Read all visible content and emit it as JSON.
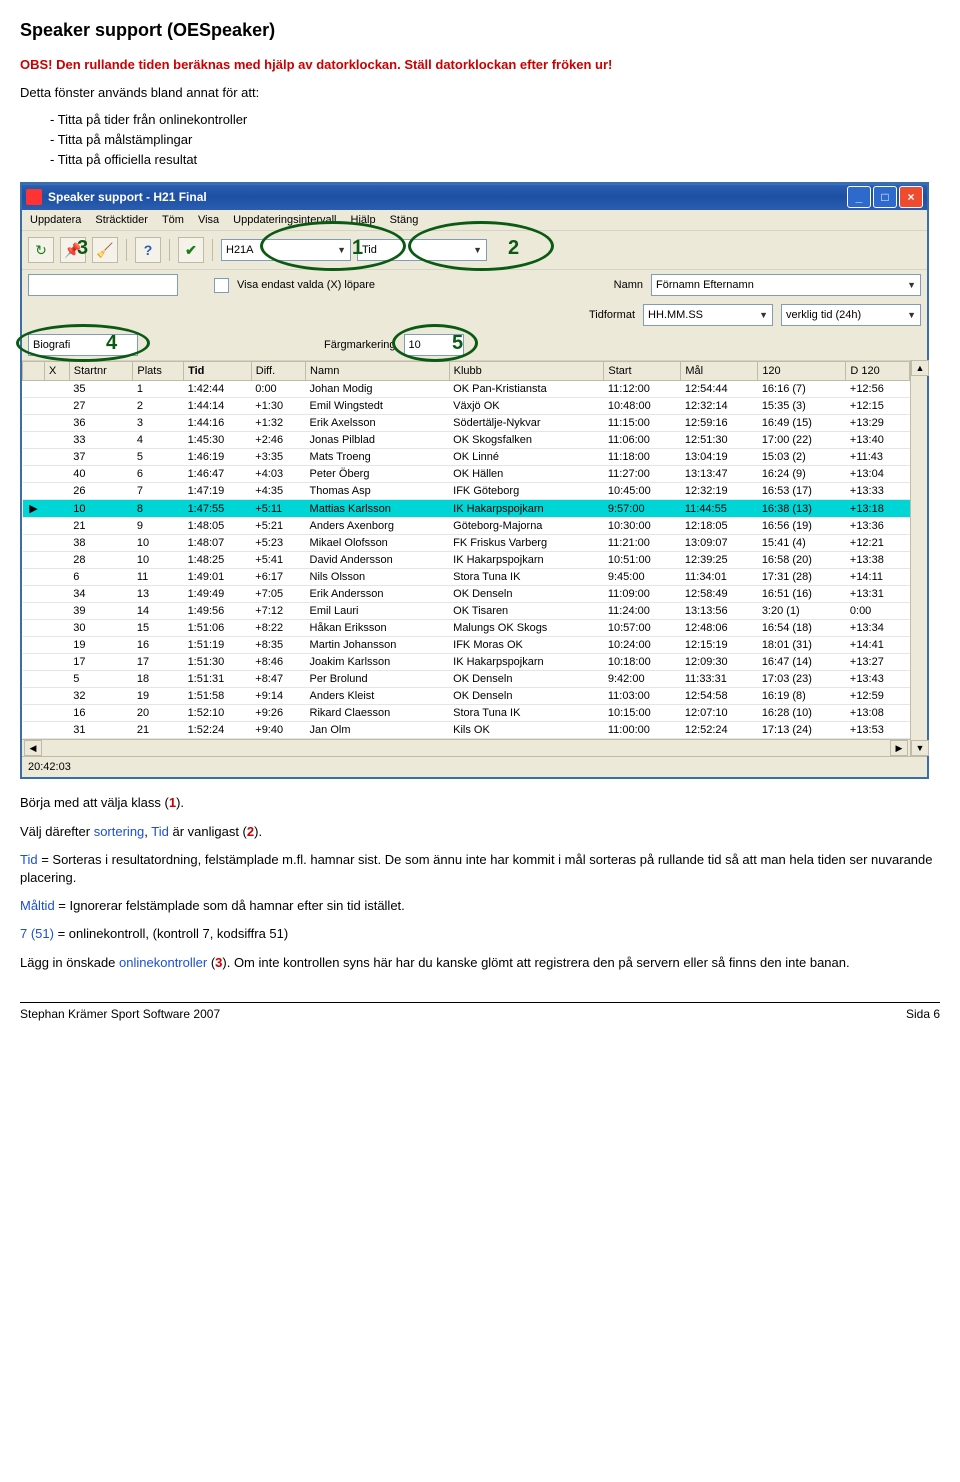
{
  "doc": {
    "heading": "Speaker support (OESpeaker)",
    "obs_line": "OBS! Den rullande tiden beräknas med hjälp av datorklockan. Ställ datorklockan efter fröken ur!",
    "intro": "Detta fönster används bland annat för att:",
    "bullets": [
      "-  Titta på tider från onlinekontroller",
      "-  Titta på målstämplingar",
      "-  Titta på officiella resultat"
    ],
    "paras": [
      {
        "type": "line",
        "parts": [
          {
            "t": "Börja med att välja klass ("
          },
          {
            "t": "1",
            "cls": "red bold"
          },
          {
            "t": ")."
          }
        ]
      },
      {
        "type": "line",
        "parts": [
          {
            "t": "Välj därefter "
          },
          {
            "t": "sortering",
            "cls": "blue"
          },
          {
            "t": ", "
          },
          {
            "t": "Tid",
            "cls": "blue"
          },
          {
            "t": " är vanligast ("
          },
          {
            "t": "2",
            "cls": "red bold"
          },
          {
            "t": ")."
          }
        ]
      },
      {
        "type": "line",
        "parts": [
          {
            "t": "Tid",
            "cls": "blue"
          },
          {
            "t": " = Sorteras i resultatordning, felstämplade m.fl. hamnar sist. De som ännu inte har kommit i mål sorteras på rullande tid så att man hela tiden ser nuvarande placering."
          }
        ]
      },
      {
        "type": "line",
        "parts": [
          {
            "t": "Måltid",
            "cls": "blue"
          },
          {
            "t": " = Ignorerar felstämplade som då hamnar efter sin tid istället."
          }
        ]
      },
      {
        "type": "line",
        "parts": [
          {
            "t": "7 (51)",
            "cls": "blue"
          },
          {
            "t": " = onlinekontroll, (kontroll 7, kodsiffra 51)"
          }
        ]
      },
      {
        "type": "line",
        "parts": [
          {
            "t": "Lägg in önskade "
          },
          {
            "t": "onlinekontroller",
            "cls": "blue"
          },
          {
            "t": " ("
          },
          {
            "t": "3",
            "cls": "red bold"
          },
          {
            "t": "). Om inte kontrollen syns här har du kanske glömt att registrera den på servern eller så finns den inte banan."
          }
        ]
      }
    ],
    "footer_left": "Stephan Krämer Sport Software 2007",
    "footer_right": "Sida 6"
  },
  "window": {
    "title": "Speaker support - H21 Final",
    "menu": [
      "Uppdatera",
      "Sträcktider",
      "Töm",
      "Visa",
      "Uppdateringsintervall",
      "Hjälp",
      "Stäng"
    ],
    "toolbar": {
      "class_value": "H21A",
      "sort_value": "Tid"
    },
    "row2": {
      "show_only_label": "Visa endast valda (X) löpare",
      "name_label": "Namn",
      "name_value": "Förnamn Efternamn"
    },
    "row3": {
      "time_label": "Tidformat",
      "time_value": "HH.MM.SS",
      "time2_value": "verklig tid (24h)"
    },
    "row4": {
      "bio_label": "Biografi",
      "color_label": "Färgmarkering",
      "color_value": "10"
    },
    "status": "20:42:03",
    "columns": [
      "",
      "X",
      "Startnr",
      "Plats",
      "Tid",
      "Diff.",
      "Namn",
      "Klubb",
      "Start",
      "Mål",
      "120",
      "D 120"
    ],
    "rows": [
      [
        "",
        "",
        "35",
        "1",
        "1:42:44",
        "0:00",
        "Johan Modig",
        "OK Pan-Kristiansta",
        "11:12:00",
        "12:54:44",
        "16:16 (7)",
        "+12:56"
      ],
      [
        "",
        "",
        "27",
        "2",
        "1:44:14",
        "+1:30",
        "Emil Wingstedt",
        "Växjö OK",
        "10:48:00",
        "12:32:14",
        "15:35 (3)",
        "+12:15"
      ],
      [
        "",
        "",
        "36",
        "3",
        "1:44:16",
        "+1:32",
        "Erik Axelsson",
        "Södertälje-Nykvar",
        "11:15:00",
        "12:59:16",
        "16:49 (15)",
        "+13:29"
      ],
      [
        "",
        "",
        "33",
        "4",
        "1:45:30",
        "+2:46",
        "Jonas Pilblad",
        "OK Skogsfalken",
        "11:06:00",
        "12:51:30",
        "17:00 (22)",
        "+13:40"
      ],
      [
        "",
        "",
        "37",
        "5",
        "1:46:19",
        "+3:35",
        "Mats Troeng",
        "OK Linné",
        "11:18:00",
        "13:04:19",
        "15:03 (2)",
        "+11:43"
      ],
      [
        "",
        "",
        "40",
        "6",
        "1:46:47",
        "+4:03",
        "Peter Öberg",
        "OK Hällen",
        "11:27:00",
        "13:13:47",
        "16:24 (9)",
        "+13:04"
      ],
      [
        "",
        "",
        "26",
        "7",
        "1:47:19",
        "+4:35",
        "Thomas Asp",
        "IFK Göteborg",
        "10:45:00",
        "12:32:19",
        "16:53 (17)",
        "+13:33"
      ],
      [
        "▶",
        "",
        "10",
        "8",
        "1:47:55",
        "+5:11",
        "Mattias Karlsson",
        "IK Hakarpspojkarn",
        "9:57:00",
        "11:44:55",
        "16:38 (13)",
        "+13:18"
      ],
      [
        "",
        "",
        "21",
        "9",
        "1:48:05",
        "+5:21",
        "Anders Axenborg",
        "Göteborg-Majorna",
        "10:30:00",
        "12:18:05",
        "16:56 (19)",
        "+13:36"
      ],
      [
        "",
        "",
        "38",
        "10",
        "1:48:07",
        "+5:23",
        "Mikael Olofsson",
        "FK Friskus Varberg",
        "11:21:00",
        "13:09:07",
        "15:41 (4)",
        "+12:21"
      ],
      [
        "",
        "",
        "28",
        "10",
        "1:48:25",
        "+5:41",
        "David Andersson",
        "IK Hakarpspojkarn",
        "10:51:00",
        "12:39:25",
        "16:58 (20)",
        "+13:38"
      ],
      [
        "",
        "",
        "6",
        "11",
        "1:49:01",
        "+6:17",
        "Nils Olsson",
        "Stora Tuna IK",
        "9:45:00",
        "11:34:01",
        "17:31 (28)",
        "+14:11"
      ],
      [
        "",
        "",
        "34",
        "13",
        "1:49:49",
        "+7:05",
        "Erik Andersson",
        "OK Denseln",
        "11:09:00",
        "12:58:49",
        "16:51 (16)",
        "+13:31"
      ],
      [
        "",
        "",
        "39",
        "14",
        "1:49:56",
        "+7:12",
        "Emil Lauri",
        "OK Tisaren",
        "11:24:00",
        "13:13:56",
        "3:20 (1)",
        "0:00"
      ],
      [
        "",
        "",
        "30",
        "15",
        "1:51:06",
        "+8:22",
        "Håkan Eriksson",
        "Malungs OK Skogs",
        "10:57:00",
        "12:48:06",
        "16:54 (18)",
        "+13:34"
      ],
      [
        "",
        "",
        "19",
        "16",
        "1:51:19",
        "+8:35",
        "Martin Johansson",
        "IFK Moras OK",
        "10:24:00",
        "12:15:19",
        "18:01 (31)",
        "+14:41"
      ],
      [
        "",
        "",
        "17",
        "17",
        "1:51:30",
        "+8:46",
        "Joakim Karlsson",
        "IK Hakarpspojkarn",
        "10:18:00",
        "12:09:30",
        "16:47 (14)",
        "+13:27"
      ],
      [
        "",
        "",
        "5",
        "18",
        "1:51:31",
        "+8:47",
        "Per Brolund",
        "OK Denseln",
        "9:42:00",
        "11:33:31",
        "17:03 (23)",
        "+13:43"
      ],
      [
        "",
        "",
        "32",
        "19",
        "1:51:58",
        "+9:14",
        "Anders Kleist",
        "OK Denseln",
        "11:03:00",
        "12:54:58",
        "16:19 (8)",
        "+12:59"
      ],
      [
        "",
        "",
        "16",
        "20",
        "1:52:10",
        "+9:26",
        "Rikard Claesson",
        "Stora Tuna IK",
        "10:15:00",
        "12:07:10",
        "16:28 (10)",
        "+13:08"
      ],
      [
        "",
        "",
        "31",
        "21",
        "1:52:24",
        "+9:40",
        "Jan Olm",
        "Kils OK",
        "11:00:00",
        "12:52:24",
        "17:13 (24)",
        "+13:53"
      ]
    ]
  },
  "labels": {
    "c1": "1",
    "c2": "2",
    "c3": "3",
    "c4": "4",
    "c5": "5"
  }
}
